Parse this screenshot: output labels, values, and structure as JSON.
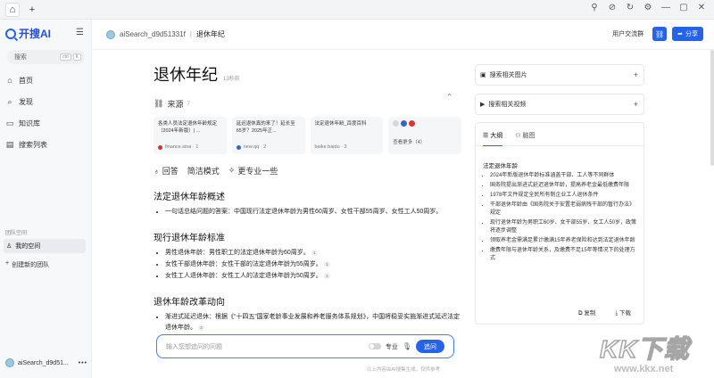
{
  "app": {
    "logo_text": "开搜AI",
    "search_placeholder": "搜索",
    "kbd_keys": [
      "ctrl",
      "K"
    ],
    "nav": [
      {
        "icon": "home-icon",
        "glyph": "⌂",
        "label": "首页"
      },
      {
        "icon": "discover-icon",
        "glyph": "⌕",
        "label": "发现"
      },
      {
        "icon": "book-icon",
        "glyph": "▭",
        "label": "知识库"
      },
      {
        "icon": "list-icon",
        "glyph": "▤",
        "label": "搜索列表"
      }
    ],
    "team_label": "团队空间",
    "my_space": "我的空间",
    "create_team": "创建新的团队",
    "user_name": "aiSearch_d9d51..."
  },
  "topbar": {
    "user": "aiSearch_d9d51331f",
    "page": "退休年纪",
    "group_link": "用户交流群",
    "share_label": "分享"
  },
  "main": {
    "title": "退休年纪",
    "time_ago": "13秒前",
    "sources_label": "来源",
    "sources_count": "7",
    "sources": [
      {
        "title": "各类人员法定退休年龄规定（2024年新版）| ...",
        "site": "finance.sina · 1"
      },
      {
        "title": "延迟退休真的来了！延长至65岁？2025年正...",
        "site": "new.qq · 2"
      },
      {
        "title": "法定退休年龄_百度百科",
        "site": "baike.baidu · 3"
      }
    ],
    "more_sources": "查看更多（4）",
    "tabs": [
      "回答",
      "简洁模式",
      "更专业一些"
    ],
    "sections": [
      {
        "heading": "法定退休年龄概述",
        "items": [
          {
            "text": "一句话总结问题的答案：中国现行法定退休年龄为男性60周岁、女性干部55周岁、女性工人50周岁。",
            "ref": ""
          }
        ]
      },
      {
        "heading": "现行退休年龄标准",
        "items": [
          {
            "text": "男性退休年龄：男性职工的法定退休年龄为60周岁。",
            "ref": "1"
          },
          {
            "text": "女性干部退休年龄：女性干部的法定退休年龄为55周岁。",
            "ref": "1"
          },
          {
            "text": "女性工人退休年龄：女性工人的法定退休年龄为50周岁。",
            "ref": "1"
          }
        ]
      },
      {
        "heading": "退休年龄改革动向",
        "items": [
          {
            "text": "渐进式延迟退休：根据《“十四五”国家老龄事业发展和养老服务体系规划》，中国将稳妥实施渐进式延迟法定退休年龄。",
            "ref": "2"
          }
        ]
      }
    ],
    "input_placeholder": "输入您想追问的问题",
    "pro_label": "专业",
    "ask_label": "追问",
    "disclaimer": "以上内容由AI搜集生成，仅供参考"
  },
  "right": {
    "images_label": "搜索相关图片",
    "videos_label": "搜索相关视频",
    "tab_outline": "大纲",
    "tab_mindmap": "脑图",
    "outline_title": "法定退休年龄",
    "outline_items": [
      "2024年新版退休年龄标准涵盖干部、工人等不同群体",
      "国务院提出渐进式延迟退休年龄，提高养老金最低缴费年限",
      "1978年文件规定全民所有制企业工人退休条件",
      "干部退休年龄由《国务院关于安置老弱病残干部的暂行办法》规定",
      "现行退休年龄为男职工60岁、女干部55岁、女工人50岁，政策将逐步调整",
      "领取养老金需满足累计缴满15年养老保险和达到法定退休年龄",
      "缴费年限与退休年龄关系，及缴费不足15年等情况下的处理方式"
    ],
    "copy_label": "复制",
    "download_label": "下载"
  },
  "watermark": {
    "text": "KK下载",
    "url": "www.kkx.net"
  }
}
